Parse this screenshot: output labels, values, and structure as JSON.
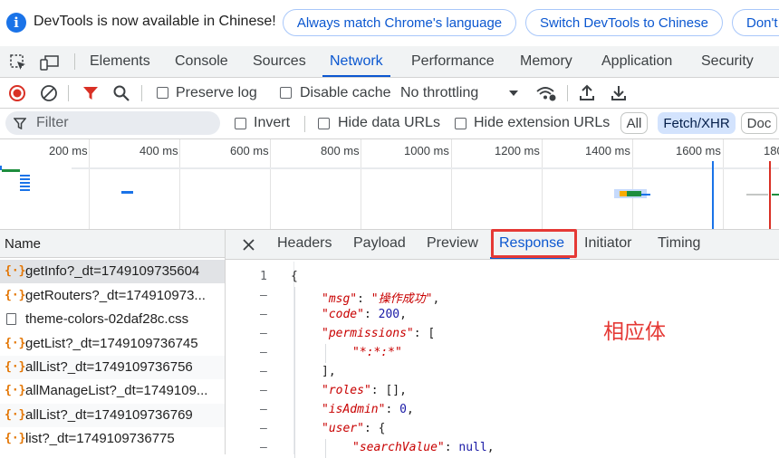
{
  "banner": {
    "message": "DevTools is now available in Chinese!",
    "buttons": [
      "Always match Chrome's language",
      "Switch DevTools to Chinese",
      "Don't"
    ]
  },
  "main_tabs": [
    "Elements",
    "Console",
    "Sources",
    "Network",
    "Performance",
    "Memory",
    "Application",
    "Security"
  ],
  "active_main_tab": "Network",
  "toolbar": {
    "preserve_log": "Preserve log",
    "disable_cache": "Disable cache",
    "throttling": "No throttling"
  },
  "filter": {
    "placeholder": "Filter",
    "invert": "Invert",
    "hide_data_urls": "Hide data URLs",
    "hide_extension_urls": "Hide extension URLs",
    "type_chips": [
      "All",
      "Fetch/XHR",
      "Doc"
    ],
    "selected_chip": "Fetch/XHR"
  },
  "timeline": {
    "ticks": [
      "200 ms",
      "400 ms",
      "600 ms",
      "800 ms",
      "1000 ms",
      "1200 ms",
      "1400 ms",
      "1600 ms",
      "180"
    ]
  },
  "request_list": {
    "header": "Name",
    "rows": [
      {
        "name": "getInfo?_dt=1749109735604",
        "type": "xhr",
        "selected": true
      },
      {
        "name": "getRouters?_dt=174910973...",
        "type": "xhr"
      },
      {
        "name": "theme-colors-02daf28c.css",
        "type": "doc"
      },
      {
        "name": "getList?_dt=1749109736745",
        "type": "xhr"
      },
      {
        "name": "allList?_dt=1749109736756",
        "type": "xhr"
      },
      {
        "name": "allManageList?_dt=1749109...",
        "type": "xhr"
      },
      {
        "name": "allList?_dt=1749109736769",
        "type": "xhr"
      },
      {
        "name": "list?_dt=1749109736775",
        "type": "xhr"
      }
    ]
  },
  "detail_tabs": [
    "Headers",
    "Payload",
    "Preview",
    "Response",
    "Initiator",
    "Timing"
  ],
  "active_detail_tab": "Response",
  "response": {
    "first_line_number": "1",
    "annotation": "相应体",
    "lines": [
      {
        "indent": 0,
        "tokens": [
          [
            "p",
            "{"
          ]
        ]
      },
      {
        "indent": 1,
        "tokens": [
          [
            "k",
            "\"msg\""
          ],
          [
            "p",
            ": "
          ],
          [
            "s",
            "\"操作成功\""
          ],
          [
            "p",
            ","
          ]
        ]
      },
      {
        "indent": 1,
        "tokens": [
          [
            "k",
            "\"code\""
          ],
          [
            "p",
            ": "
          ],
          [
            "n",
            "200"
          ],
          [
            "p",
            ","
          ]
        ]
      },
      {
        "indent": 1,
        "tokens": [
          [
            "k",
            "\"permissions\""
          ],
          [
            "p",
            ": ["
          ]
        ]
      },
      {
        "indent": 2,
        "tokens": [
          [
            "s",
            "\"*:*:*\""
          ]
        ]
      },
      {
        "indent": 1,
        "tokens": [
          [
            "p",
            "],"
          ]
        ]
      },
      {
        "indent": 1,
        "tokens": [
          [
            "k",
            "\"roles\""
          ],
          [
            "p",
            ": [],"
          ]
        ]
      },
      {
        "indent": 1,
        "tokens": [
          [
            "k",
            "\"isAdmin\""
          ],
          [
            "p",
            ": "
          ],
          [
            "n",
            "0"
          ],
          [
            "p",
            ","
          ]
        ]
      },
      {
        "indent": 1,
        "tokens": [
          [
            "k",
            "\"user\""
          ],
          [
            "p",
            ": {"
          ]
        ]
      },
      {
        "indent": 2,
        "tokens": [
          [
            "k",
            "\"searchValue\""
          ],
          [
            "p",
            ": "
          ],
          [
            "n",
            "null"
          ],
          [
            "p",
            ","
          ]
        ]
      }
    ]
  },
  "colors": {
    "accent": "#0b57d0",
    "highlight_box": "#e53935",
    "annotation": "#e53935"
  }
}
